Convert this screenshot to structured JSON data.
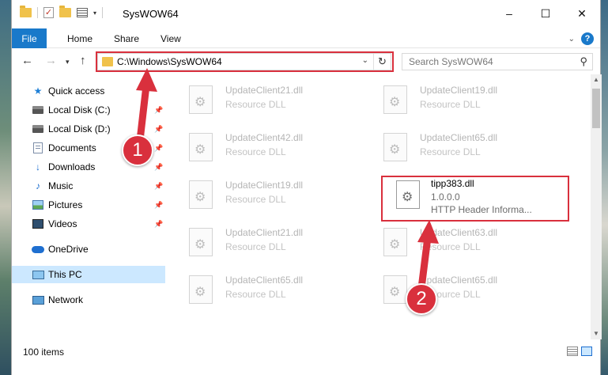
{
  "window": {
    "title": "SysWOW64",
    "controls": {
      "minimize": "–",
      "maximize": "☐",
      "close": "✕"
    }
  },
  "ribbon": {
    "tabs": [
      "File",
      "Home",
      "Share",
      "View"
    ]
  },
  "address_bar": {
    "path": "C:\\Windows\\SysWOW64"
  },
  "search": {
    "placeholder": "Search SysWOW64"
  },
  "nav_pane": {
    "items": [
      {
        "label": "Quick access",
        "icon": "star-icon",
        "pinned": false
      },
      {
        "label": "Local Disk (C:)",
        "icon": "disk-icon",
        "pinned": true
      },
      {
        "label": "Local Disk (D:)",
        "icon": "disk-icon",
        "pinned": true
      },
      {
        "label": "Documents",
        "icon": "documents-icon",
        "pinned": true
      },
      {
        "label": "Downloads",
        "icon": "downloads-icon",
        "pinned": true
      },
      {
        "label": "Music",
        "icon": "music-icon",
        "pinned": true
      },
      {
        "label": "Pictures",
        "icon": "pictures-icon",
        "pinned": true
      },
      {
        "label": "Videos",
        "icon": "videos-icon",
        "pinned": true
      },
      {
        "label": "OneDrive",
        "icon": "onedrive-icon",
        "pinned": false
      },
      {
        "label": "This PC",
        "icon": "pc-icon",
        "pinned": false,
        "selected": true
      },
      {
        "label": "Network",
        "icon": "network-icon",
        "pinned": false
      }
    ]
  },
  "files": [
    {
      "name": "UpdateClient21.dll",
      "type": "Resource DLL"
    },
    {
      "name": "UpdateClient19.dll",
      "type": "Resource DLL"
    },
    {
      "name": "UpdateClient42.dll",
      "type": "Resource DLL"
    },
    {
      "name": "UpdateClient65.dll",
      "type": "Resource DLL"
    },
    {
      "name": "UpdateClient19.dll",
      "type": "Resource DLL"
    },
    {
      "name": "tipp383.dll",
      "version": "1.0.0.0",
      "type": "HTTP Header Informa...",
      "highlighted": true
    },
    {
      "name": "UpdateClient21.dll",
      "type": "Resource DLL"
    },
    {
      "name": "UpdateClient63.dll",
      "type": "Resource DLL"
    },
    {
      "name": "UpdateClient65.dll",
      "type": "Resource DLL"
    },
    {
      "name": "UpdateClient65.dll",
      "type": "Resource DLL"
    }
  ],
  "status": {
    "item_count": "100 items"
  },
  "annotations": {
    "step1": "1",
    "step2": "2",
    "color": "#d9303d"
  }
}
